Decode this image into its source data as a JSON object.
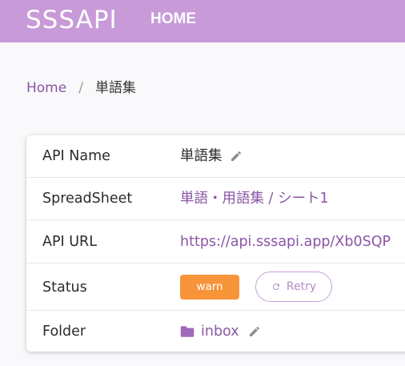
{
  "header": {
    "logo_text": "SSSAPI",
    "nav_home": "HOME",
    "bg_color": "#c89ad8"
  },
  "breadcrumb": {
    "home": "Home",
    "separator": "/",
    "current": "単語集"
  },
  "details": {
    "api_name": {
      "label": "API Name",
      "value": "単語集",
      "icon": "pencil-icon"
    },
    "spreadsheet": {
      "label": "SpreadSheet",
      "value": "単語・用語集 / シート1"
    },
    "api_url": {
      "label": "API URL",
      "value": "https://api.sssapi.app/Xb0SQP"
    },
    "status": {
      "label": "Status",
      "badge": "warn",
      "badge_color": "#f7943a",
      "retry_label": "Retry",
      "retry_icon": "refresh-icon"
    },
    "folder": {
      "label": "Folder",
      "value": "inbox",
      "icon": "folder-icon",
      "edit_icon": "pencil-icon"
    }
  },
  "colors": {
    "accent": "#8a56a6",
    "warn": "#f7943a"
  }
}
